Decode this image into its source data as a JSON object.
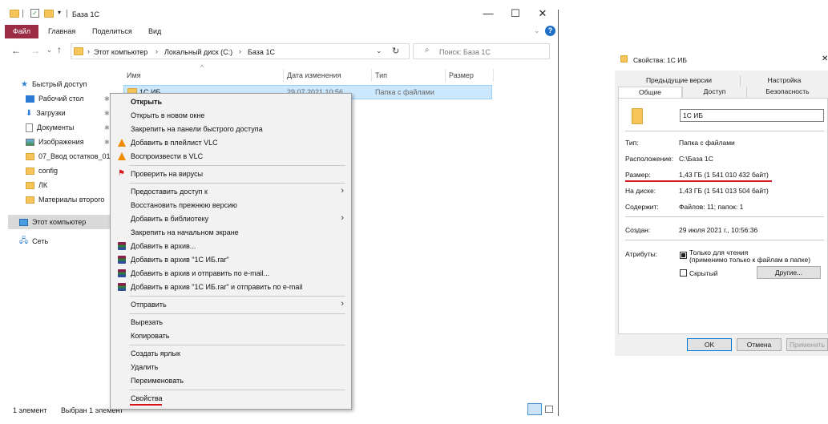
{
  "explorer": {
    "title": "База 1С",
    "window_controls": [
      "—",
      "☐",
      "✕"
    ],
    "ribbon": {
      "file_tab": "Файл",
      "tabs": [
        "Главная",
        "Поделиться",
        "Вид"
      ]
    },
    "address": {
      "path": [
        "Этот компьютер",
        "Локальный диск (C:)",
        "База 1С"
      ],
      "search_placeholder": "Поиск: База 1С"
    },
    "sidebar": [
      {
        "label": "Быстрый доступ",
        "icon": "star-icon"
      },
      {
        "label": "Рабочий стол",
        "icon": "desktop-icon",
        "pinned": true
      },
      {
        "label": "Загрузки",
        "icon": "download-icon",
        "pinned": true
      },
      {
        "label": "Документы",
        "icon": "documents-icon",
        "pinned": true
      },
      {
        "label": "Изображения",
        "icon": "pictures-icon",
        "pinned": true
      },
      {
        "label": "07_Ввод остатков_01",
        "icon": "folder-icon"
      },
      {
        "label": "config",
        "icon": "folder-icon"
      },
      {
        "label": "ЛК",
        "icon": "folder-icon"
      },
      {
        "label": "Материалы второго",
        "icon": "folder-icon"
      },
      {
        "label": "Этот компьютер",
        "icon": "computer-icon"
      },
      {
        "label": "Сеть",
        "icon": "network-icon"
      }
    ],
    "columns": [
      "Имя",
      "Дата изменения",
      "Тип",
      "Размер"
    ],
    "rows": [
      {
        "name": "1С ИБ",
        "date": "29.07.2021 10:56",
        "type": "Папка с файлами",
        "size": ""
      }
    ],
    "status": {
      "count": "1 элемент",
      "selected": "Выбран 1 элемент"
    }
  },
  "context_menu": {
    "items": [
      "Открыть",
      "Открыть в новом окне",
      "Закрепить на панели быстрого доступа",
      "Добавить в плейлист VLC",
      "Воспроизвести в VLC",
      "Проверить на вирусы",
      "Предоставить доступ к",
      "Восстановить прежнюю версию",
      "Добавить в библиотеку",
      "Закрепить на начальном экране",
      "Добавить в архив...",
      "Добавить в архив \"1С ИБ.rar\"",
      "Добавить в архив и отправить по e-mail...",
      "Добавить в архив \"1С ИБ.rar\" и отправить по e-mail",
      "Отправить",
      "Вырезать",
      "Копировать",
      "Создать ярлык",
      "Удалить",
      "Переименовать",
      "Свойства"
    ]
  },
  "properties": {
    "title": "Свойства: 1С ИБ",
    "tabs_top": [
      "Предыдущие версии",
      "Настройка"
    ],
    "tabs_bottom": [
      "Общие",
      "Доступ",
      "Безопасность"
    ],
    "name": "1С ИБ",
    "rows": {
      "type_label": "Тип:",
      "type_value": "Папка с файлами",
      "location_label": "Расположение:",
      "location_value": "C:\\База 1С",
      "size_label": "Размер:",
      "size_value": "1,43 ГБ (1 541 010 432 байт)",
      "disk_label": "На диске:",
      "disk_value": "1,43 ГБ (1 541 013 504 байт)",
      "contains_label": "Содержит:",
      "contains_value": "Файлов: 11; папок: 1",
      "created_label": "Создан:",
      "created_value": "29 июля 2021 г., 10:56:36",
      "attrs_label": "Атрибуты:",
      "readonly_line1": "Только для чтения",
      "readonly_line2": "(применимо только к файлам в папке)",
      "hidden": "Скрытый",
      "other_button": "Другие..."
    },
    "buttons": {
      "ok": "OK",
      "cancel": "Отмена",
      "apply": "Применить"
    },
    "close": "✕"
  },
  "colors": {
    "file_tab": "#9b2c44",
    "selection": "#cce8ff",
    "red_underline": "#d8141c"
  }
}
